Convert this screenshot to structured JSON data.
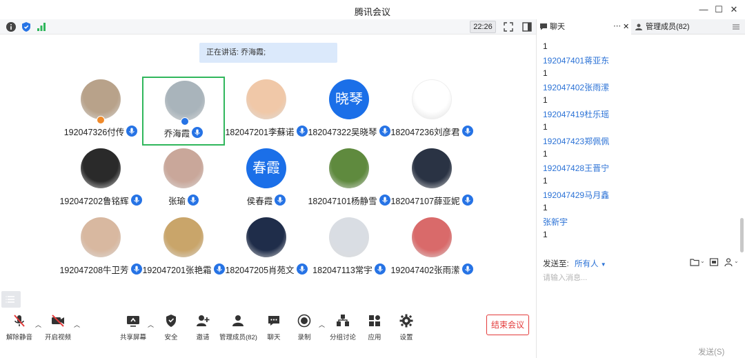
{
  "window": {
    "title": "腾讯会议"
  },
  "topbar": {
    "time": "22:26"
  },
  "speaking": {
    "text": "正在讲话: 乔海霞;"
  },
  "participants": [
    {
      "name": "192047326付传",
      "avatar": "photo",
      "color": "#b8a28a",
      "badge": "#f08a2a"
    },
    {
      "name": "乔海霞",
      "avatar": "photo",
      "color": "#a9b4bb",
      "badge": "#2673e5",
      "active": true
    },
    {
      "name": "182047201李蘇诺",
      "avatar": "photo",
      "color": "#f0c8a8"
    },
    {
      "name": "182047322吴晓琴",
      "avatar": "text",
      "avatar_text": "晓琴"
    },
    {
      "name": "182047236刘彦君",
      "avatar": "photo",
      "color": "#ffffff"
    },
    {
      "name": "192047202鲁铭辉",
      "avatar": "photo",
      "color": "#2a2a2a"
    },
    {
      "name": "张瑜",
      "avatar": "photo",
      "color": "#c9a79a"
    },
    {
      "name": "侯春霞",
      "avatar": "text",
      "avatar_text": "春霞"
    },
    {
      "name": "182047101杨静雪",
      "avatar": "photo",
      "color": "#5f8a3e"
    },
    {
      "name": "182047107薛亚妮",
      "avatar": "photo",
      "color": "#2a3344"
    },
    {
      "name": "192047208牛卫芳",
      "avatar": "photo",
      "color": "#d8b8a0"
    },
    {
      "name": "192047201张艳霜",
      "avatar": "photo",
      "color": "#c9a56a"
    },
    {
      "name": "182047205肖苑文",
      "avatar": "photo",
      "color": "#1f2d4a"
    },
    {
      "name": "182047113常宇",
      "avatar": "photo",
      "color": "#d9dde3"
    },
    {
      "name": "192047402张雨潆",
      "avatar": "photo",
      "color": "#d96a6a"
    }
  ],
  "toolbar": {
    "unmute": "解除静音",
    "video": "开启视频",
    "share": "共享屏幕",
    "security": "安全",
    "invite": "邀请",
    "members": "管理成员(82)",
    "chat": "聊天",
    "record": "录制",
    "breakout": "分组讨论",
    "apps": "应用",
    "settings": "设置",
    "end": "结束会议"
  },
  "right_panel": {
    "chat_tab": "聊天",
    "members_tab": "管理成员(82)",
    "messages": [
      {
        "name": "192047401蒋亚东",
        "text": "1"
      },
      {
        "name": "192047402张雨潆",
        "text": "1"
      },
      {
        "name": "192047419杜乐瑶",
        "text": "1"
      },
      {
        "name": "192047423郑佩佩",
        "text": "1"
      },
      {
        "name": "192047428王晋宁",
        "text": "1"
      },
      {
        "name": "192047429马月鑫",
        "text": "1"
      },
      {
        "name": "张新宇",
        "text": "1"
      }
    ],
    "first_text": "1",
    "send_to_label": "发送至:",
    "send_target": "所有人",
    "input_placeholder": "请输入消息...",
    "send_button": "发送(S)"
  },
  "colors": {
    "accent": "#2673e5",
    "active_border": "#2fb65b",
    "danger": "#e33a3a",
    "link": "#2b72d6"
  }
}
